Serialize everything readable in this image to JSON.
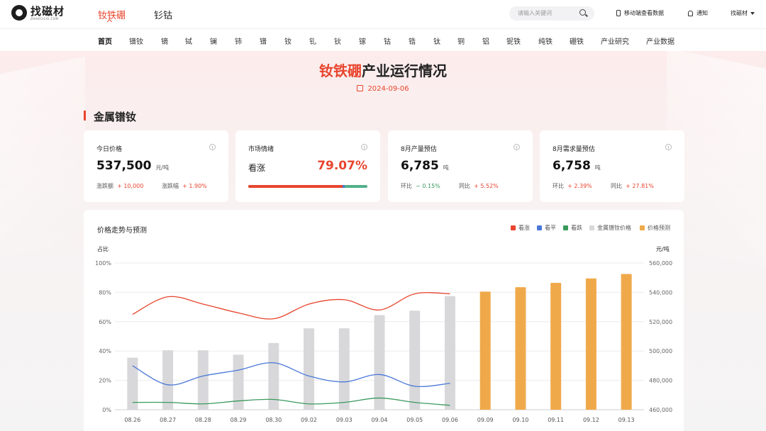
{
  "header": {
    "logo_name": "找磁材",
    "logo_sub": "ZHAOCICAI.COM",
    "tabs": [
      {
        "label": "钕铁硼"
      },
      {
        "label": "钐钴"
      }
    ],
    "search_placeholder": "请输入关键词",
    "mobile_label": "移动端查看数据",
    "notice_label": "通知",
    "user_label": "找磁材"
  },
  "nav": {
    "items": [
      {
        "label": "首页"
      },
      {
        "label": "镨钕"
      },
      {
        "label": "镝"
      },
      {
        "label": "铽"
      },
      {
        "label": "镧"
      },
      {
        "label": "铈"
      },
      {
        "label": "镨"
      },
      {
        "label": "钕"
      },
      {
        "label": "钆"
      },
      {
        "label": "钬"
      },
      {
        "label": "镓"
      },
      {
        "label": "钴"
      },
      {
        "label": "锆"
      },
      {
        "label": "钛"
      },
      {
        "label": "铜"
      },
      {
        "label": "铝"
      },
      {
        "label": "铌铁"
      },
      {
        "label": "纯铁"
      },
      {
        "label": "硼铁"
      },
      {
        "label": "产业研究"
      },
      {
        "label": "产业数据"
      }
    ]
  },
  "page": {
    "title_highlight": "钕铁硼",
    "title_rest": "产业运行情况",
    "date": "2024-09-06",
    "section_title": "金属镨钕"
  },
  "cards": {
    "price": {
      "label": "今日价格",
      "value": "537,500",
      "unit": "元/吨",
      "sub1_label": "涨跌额",
      "sub1_value": "+ 10,000",
      "sub2_label": "涨跌幅",
      "sub2_value": "+ 1.90%"
    },
    "mood": {
      "label": "市场情绪",
      "status": "看涨",
      "percent": "79.07%",
      "up_fraction": 0.7907,
      "flat_fraction": 0.02
    },
    "output": {
      "label": "8月产量预估",
      "value": "6,785",
      "unit": "吨",
      "sub1_label": "环比",
      "sub1_value": "− 0.15%",
      "sub2_label": "同比",
      "sub2_value": "+ 5.52%"
    },
    "demand": {
      "label": "8月需求量预估",
      "value": "6,758",
      "unit": "吨",
      "sub1_label": "环比",
      "sub1_value": "+ 2.39%",
      "sub2_label": "同比",
      "sub2_value": "+ 27.81%"
    }
  },
  "chart_section": {
    "title": "价格走势与预测",
    "left_axis_title": "占比",
    "right_axis_title": "元/吨"
  },
  "colors": {
    "accent": "#e8452e",
    "up": "#e8452e",
    "flat": "#4a78d8",
    "down": "#3a9a5c",
    "price_bar": "#d8d8db",
    "forecast_bar": "#f0a94a"
  },
  "chart_data": {
    "type": "bar",
    "title": "价格走势与预测",
    "categories": [
      "08.26",
      "08.27",
      "08.28",
      "08.29",
      "08.30",
      "09.02",
      "09.03",
      "09.04",
      "09.05",
      "09.06",
      "09.09",
      "09.10",
      "09.11",
      "09.12",
      "09.13"
    ],
    "left_axis": {
      "label": "占比",
      "ylim": [
        0,
        100
      ],
      "ticks": [
        "0%",
        "20%",
        "40%",
        "60%",
        "80%",
        "100%"
      ]
    },
    "right_axis": {
      "label": "元/吨",
      "ylim": [
        460000,
        560000
      ],
      "ticks": [
        "460,000",
        "480,000",
        "500,000",
        "520,000",
        "540,000",
        "560,000"
      ]
    },
    "legend": [
      {
        "name": "看涨",
        "color": "#e8452e"
      },
      {
        "name": "看平",
        "color": "#4a78d8"
      },
      {
        "name": "看跌",
        "color": "#3a9a5c"
      },
      {
        "name": "金属镨钕价格",
        "color": "#d8d8db"
      },
      {
        "name": "价格预测",
        "color": "#f0a94a"
      }
    ],
    "series": [
      {
        "name": "看涨",
        "type": "line",
        "axis": "left",
        "values": [
          65,
          77,
          72,
          66,
          62,
          72,
          75,
          68,
          79,
          79,
          null,
          null,
          null,
          null,
          null
        ]
      },
      {
        "name": "看平",
        "type": "line",
        "axis": "left",
        "values": [
          30,
          17,
          23,
          27,
          32,
          23,
          19,
          24,
          16,
          18,
          null,
          null,
          null,
          null,
          null
        ]
      },
      {
        "name": "看跌",
        "type": "line",
        "axis": "left",
        "values": [
          5,
          5,
          4,
          6,
          7,
          4,
          5,
          8,
          5,
          3,
          null,
          null,
          null,
          null,
          null
        ]
      },
      {
        "name": "金属镨钕价格",
        "type": "bar",
        "axis": "right",
        "values": [
          495500,
          500500,
          500500,
          497500,
          505500,
          515500,
          515500,
          524500,
          527500,
          537500,
          null,
          null,
          null,
          null,
          null
        ]
      },
      {
        "name": "价格预测",
        "type": "bar",
        "axis": "right",
        "values": [
          null,
          null,
          null,
          null,
          null,
          null,
          null,
          null,
          null,
          null,
          540500,
          543500,
          546500,
          549500,
          552500
        ]
      }
    ],
    "grid": true,
    "legend_position": "top-right"
  }
}
